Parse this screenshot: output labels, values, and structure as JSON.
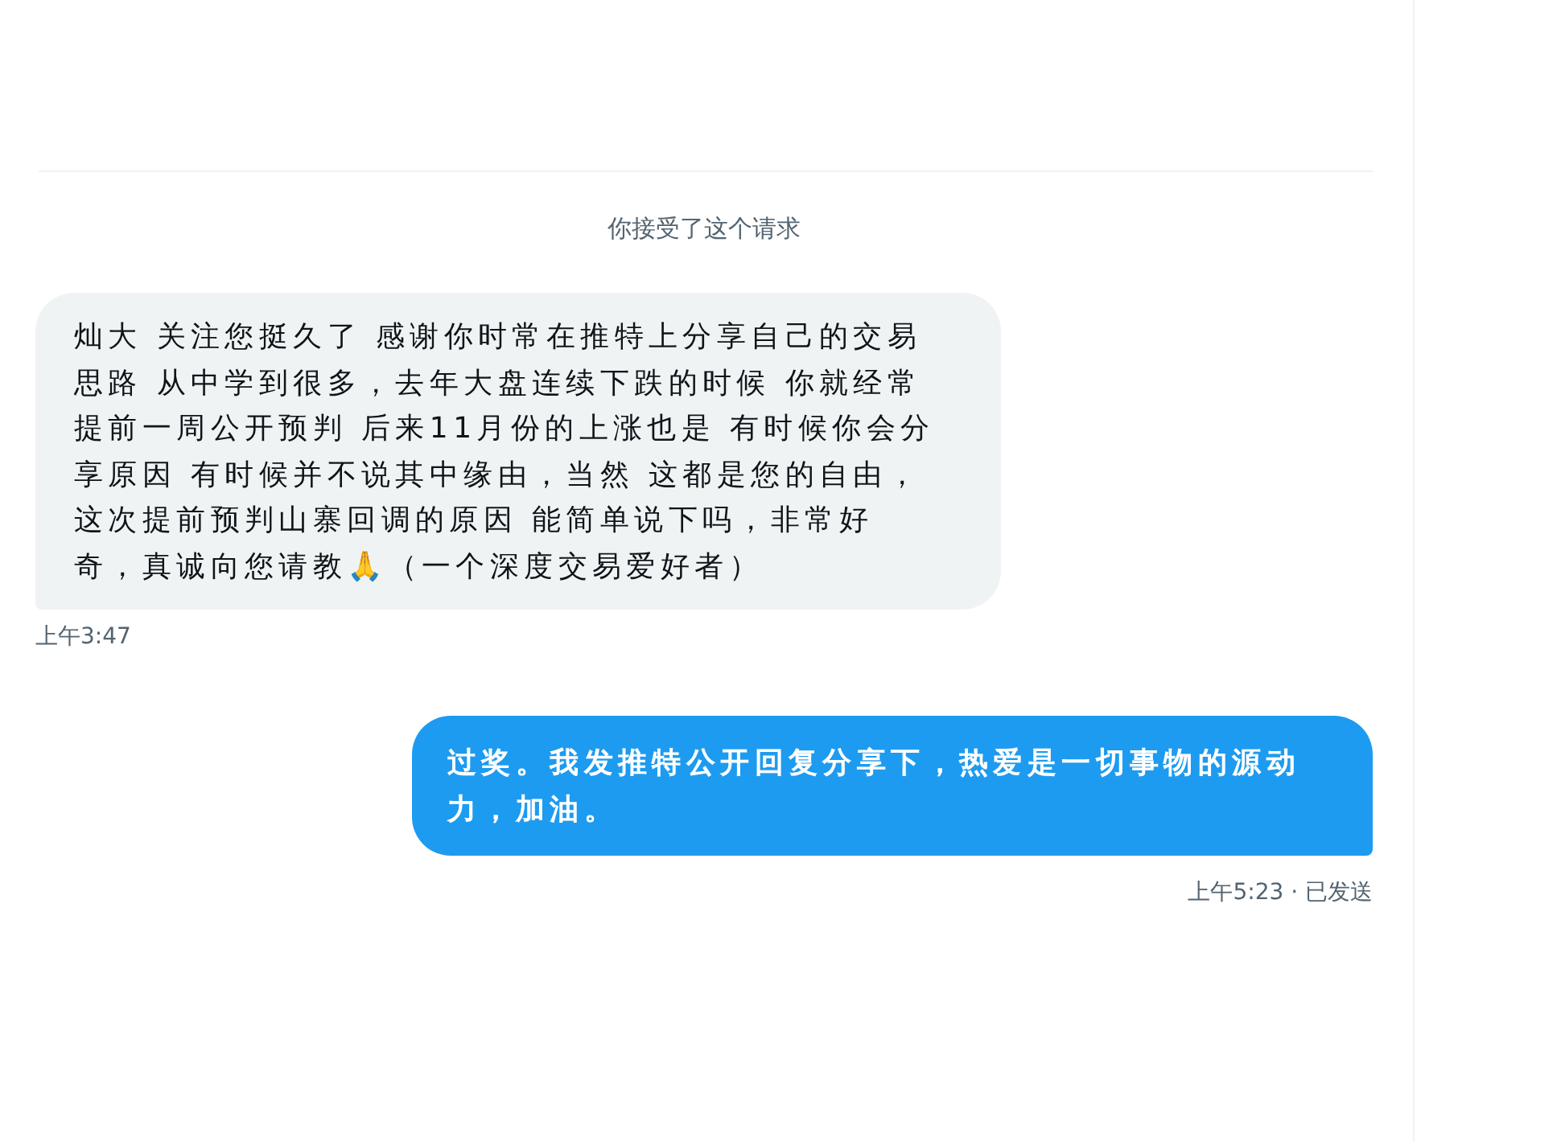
{
  "notice": "你接受了这个请求",
  "messages": [
    {
      "kind": "received",
      "text": "灿大 关注您挺久了 感谢你时常在推特上分享自己的交易思路 从中学到很多，去年大盘连续下跌的时候 你就经常提前一周公开预判 后来11月份的上涨也是 有时候你会分享原因 有时候并不说其中缘由，当然 这都是您的自由，这次提前预判山寨回调的原因 能简单说下吗，非常好奇，真诚向您请教🙏（一个深度交易爱好者）",
      "time": "上午3:47"
    },
    {
      "kind": "sent",
      "text": "过奖。我发推特公开回复分享下，热爱是一切事物的源动力，加油。",
      "time": "上午5:23 · 已发送"
    }
  ]
}
